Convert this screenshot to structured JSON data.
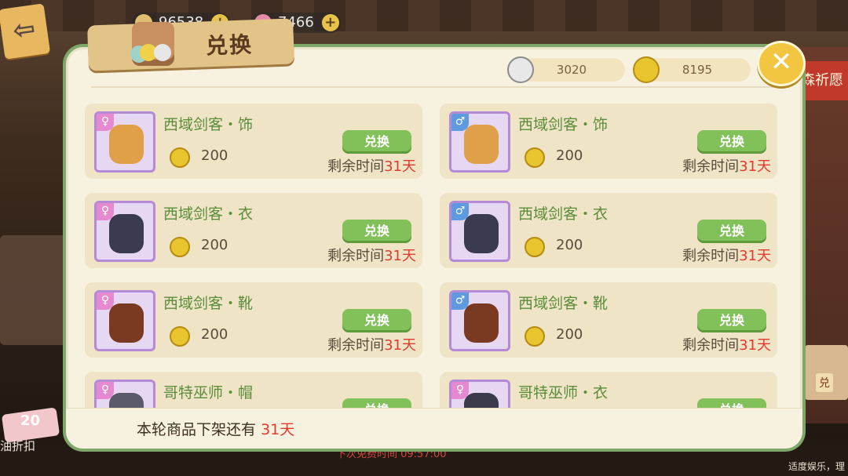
{
  "top_currency": [
    {
      "value": "96538"
    },
    {
      "value": "7466"
    }
  ],
  "panel": {
    "title": "兑换",
    "currency_silver": "3020",
    "currency_gold": "8195",
    "close_label": "✕",
    "footer_prefix": "本轮商品下架还有",
    "footer_days": "31天"
  },
  "items": [
    {
      "name": "西域剑客・饰",
      "gender": "♀",
      "price": "200",
      "button": "兑换",
      "remain_prefix": "剩余时间",
      "remain_days": "31天"
    },
    {
      "name": "西域剑客・饰",
      "gender": "♂",
      "price": "200",
      "button": "兑换",
      "remain_prefix": "剩余时间",
      "remain_days": "31天"
    },
    {
      "name": "西域剑客・衣",
      "gender": "♀",
      "price": "200",
      "button": "兑换",
      "remain_prefix": "剩余时间",
      "remain_days": "31天"
    },
    {
      "name": "西域剑客・衣",
      "gender": "♂",
      "price": "200",
      "button": "兑换",
      "remain_prefix": "剩余时间",
      "remain_days": "31天"
    },
    {
      "name": "西域剑客・靴",
      "gender": "♀",
      "price": "200",
      "button": "兑换",
      "remain_prefix": "剩余时间",
      "remain_days": "31天"
    },
    {
      "name": "西域剑客・靴",
      "gender": "♂",
      "price": "200",
      "button": "兑换",
      "remain_prefix": "剩余时间",
      "remain_days": "31天"
    },
    {
      "name": "哥特巫师・帽",
      "gender": "♀",
      "price": "",
      "button": "兑换",
      "remain_prefix": "",
      "remain_days": ""
    },
    {
      "name": "哥特巫师・衣",
      "gender": "♀",
      "price": "",
      "button": "兑换",
      "remain_prefix": "",
      "remain_days": ""
    }
  ],
  "side": {
    "right_banner": "森祈愿",
    "right_box": "兑",
    "discount_number": "20",
    "discount_label": "油折扣",
    "free_text": "下次免费时间  09:57:00",
    "age_text": "适度娱乐，理"
  },
  "colors": {
    "panel_border": "#7ea86a",
    "green_text": "#5b8c3a",
    "red_days": "#e23a2e",
    "button_green": "#82c05a"
  }
}
